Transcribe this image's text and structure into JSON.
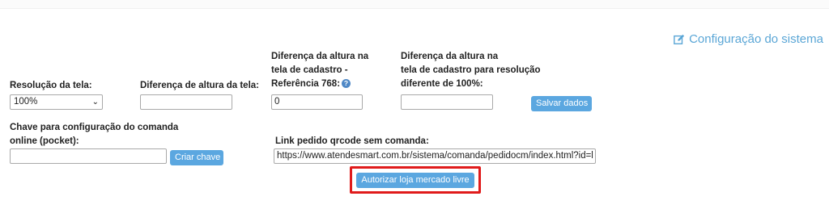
{
  "header": {
    "config_link_label": "Configuração do sistema",
    "config_icon": "edit-icon",
    "link_color": "#5aa6d6"
  },
  "form": {
    "resolucao": {
      "label": "Resolução da tela:",
      "value": "100%"
    },
    "diferenca_altura": {
      "label": "Diferença de altura da tela:",
      "value": ""
    },
    "diferenca_cadastro_768": {
      "label_line1": "Diferença da altura na",
      "label_line2": "tela de cadastro -",
      "label_line3": "Referência 768:",
      "help_icon": "?",
      "value": "0"
    },
    "diferenca_cadastro_resolucao": {
      "label_line1": "Diferença da altura na",
      "label_line2": "tela de cadastro para resolução",
      "label_line3": "diferente de 100%:",
      "value": ""
    },
    "salvar_button": "Salvar dados",
    "chave": {
      "label_line1": "Chave para configuração do comanda",
      "label_line2": "online (pocket):",
      "value": "",
      "button": "Criar chave"
    },
    "link_qrcode": {
      "label": "Link pedido qrcode sem comanda:",
      "value": "https://www.atendesmart.com.br/sistema/comanda/pedidocm/index.html?id=l"
    },
    "autorizar_button": "Autorizar loja mercado livre"
  },
  "colors": {
    "button": "#5ba7e0",
    "highlight": "#e01b1b"
  }
}
